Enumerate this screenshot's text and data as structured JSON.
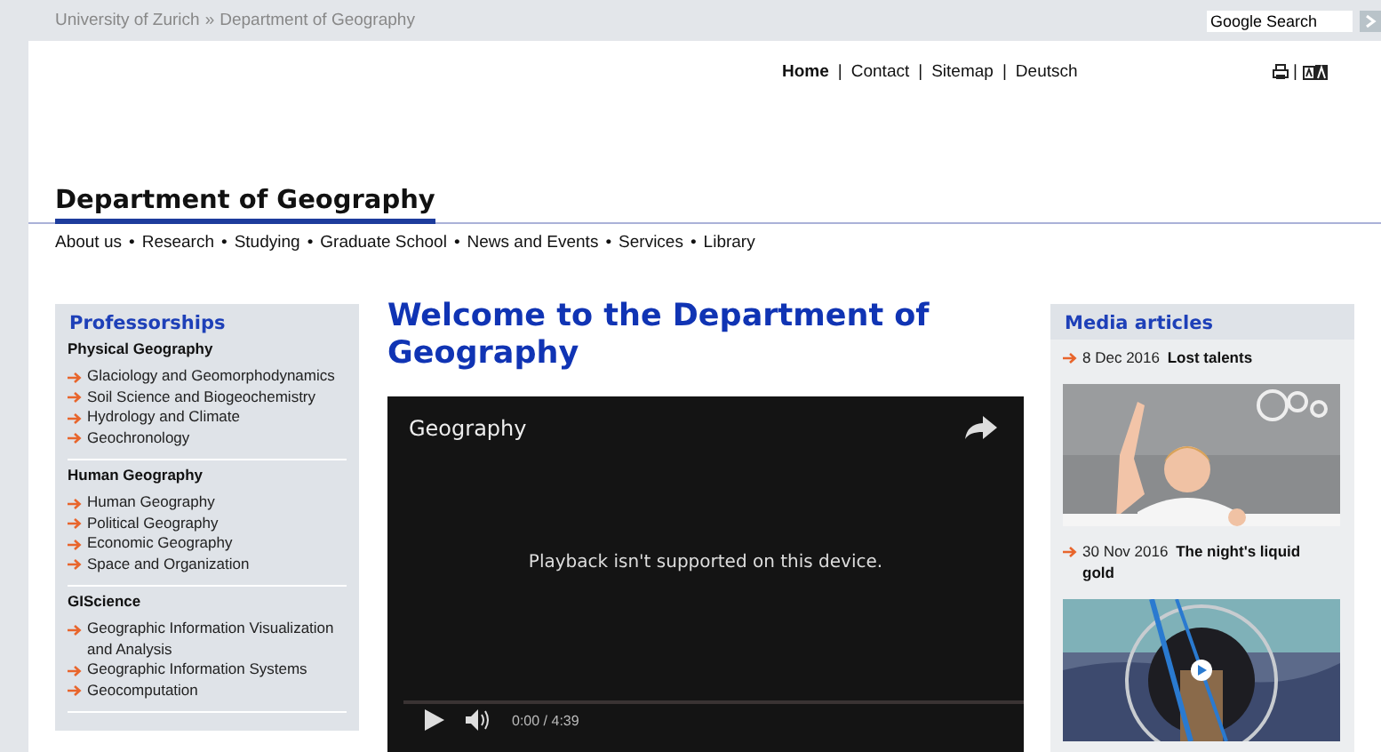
{
  "breadcrumb": {
    "items": [
      "University of Zurich",
      "Department of Geography"
    ],
    "separator": "»"
  },
  "search": {
    "value": "Google Search"
  },
  "service_links": {
    "separator": "|",
    "items": [
      {
        "label": "Home",
        "selected": true
      },
      {
        "label": "Contact",
        "selected": false
      },
      {
        "label": "Sitemap",
        "selected": false
      },
      {
        "label": "Deutsch",
        "selected": false
      }
    ]
  },
  "tools_separator": "|",
  "site_title": "Department of Geography",
  "main_nav": {
    "separator": "•",
    "items": [
      "About us",
      "Research",
      "Studying",
      "Graduate School",
      "News and Events",
      "Services",
      "Library"
    ]
  },
  "sidebar": {
    "title": "Professorships",
    "groups": [
      {
        "heading": "Physical Geography",
        "items": [
          "Glaciology and Geomorphodynamics",
          "Soil Science and Biogeochemistry",
          "Hydrology and Climate",
          "Geochronology"
        ]
      },
      {
        "heading": "Human Geography",
        "items": [
          "Human Geography",
          "Political Geography",
          "Economic Geography",
          "Space and Organization"
        ]
      },
      {
        "heading": "GIScience",
        "items": [
          "Geographic Information Visualization and Analysis",
          "Geographic Information Systems",
          "Geocomputation"
        ]
      }
    ]
  },
  "main": {
    "heading": "Welcome to the Department of Geography",
    "video": {
      "title": "Geography",
      "message": "Playback isn't supported on this device.",
      "time": "0:00 / 4:39"
    }
  },
  "media": {
    "title": "Media articles",
    "articles": [
      {
        "date": "8 Dec 2016",
        "title": "Lost talents"
      },
      {
        "date": "30 Nov 2016",
        "title": "The night's liquid gold"
      }
    ]
  }
}
